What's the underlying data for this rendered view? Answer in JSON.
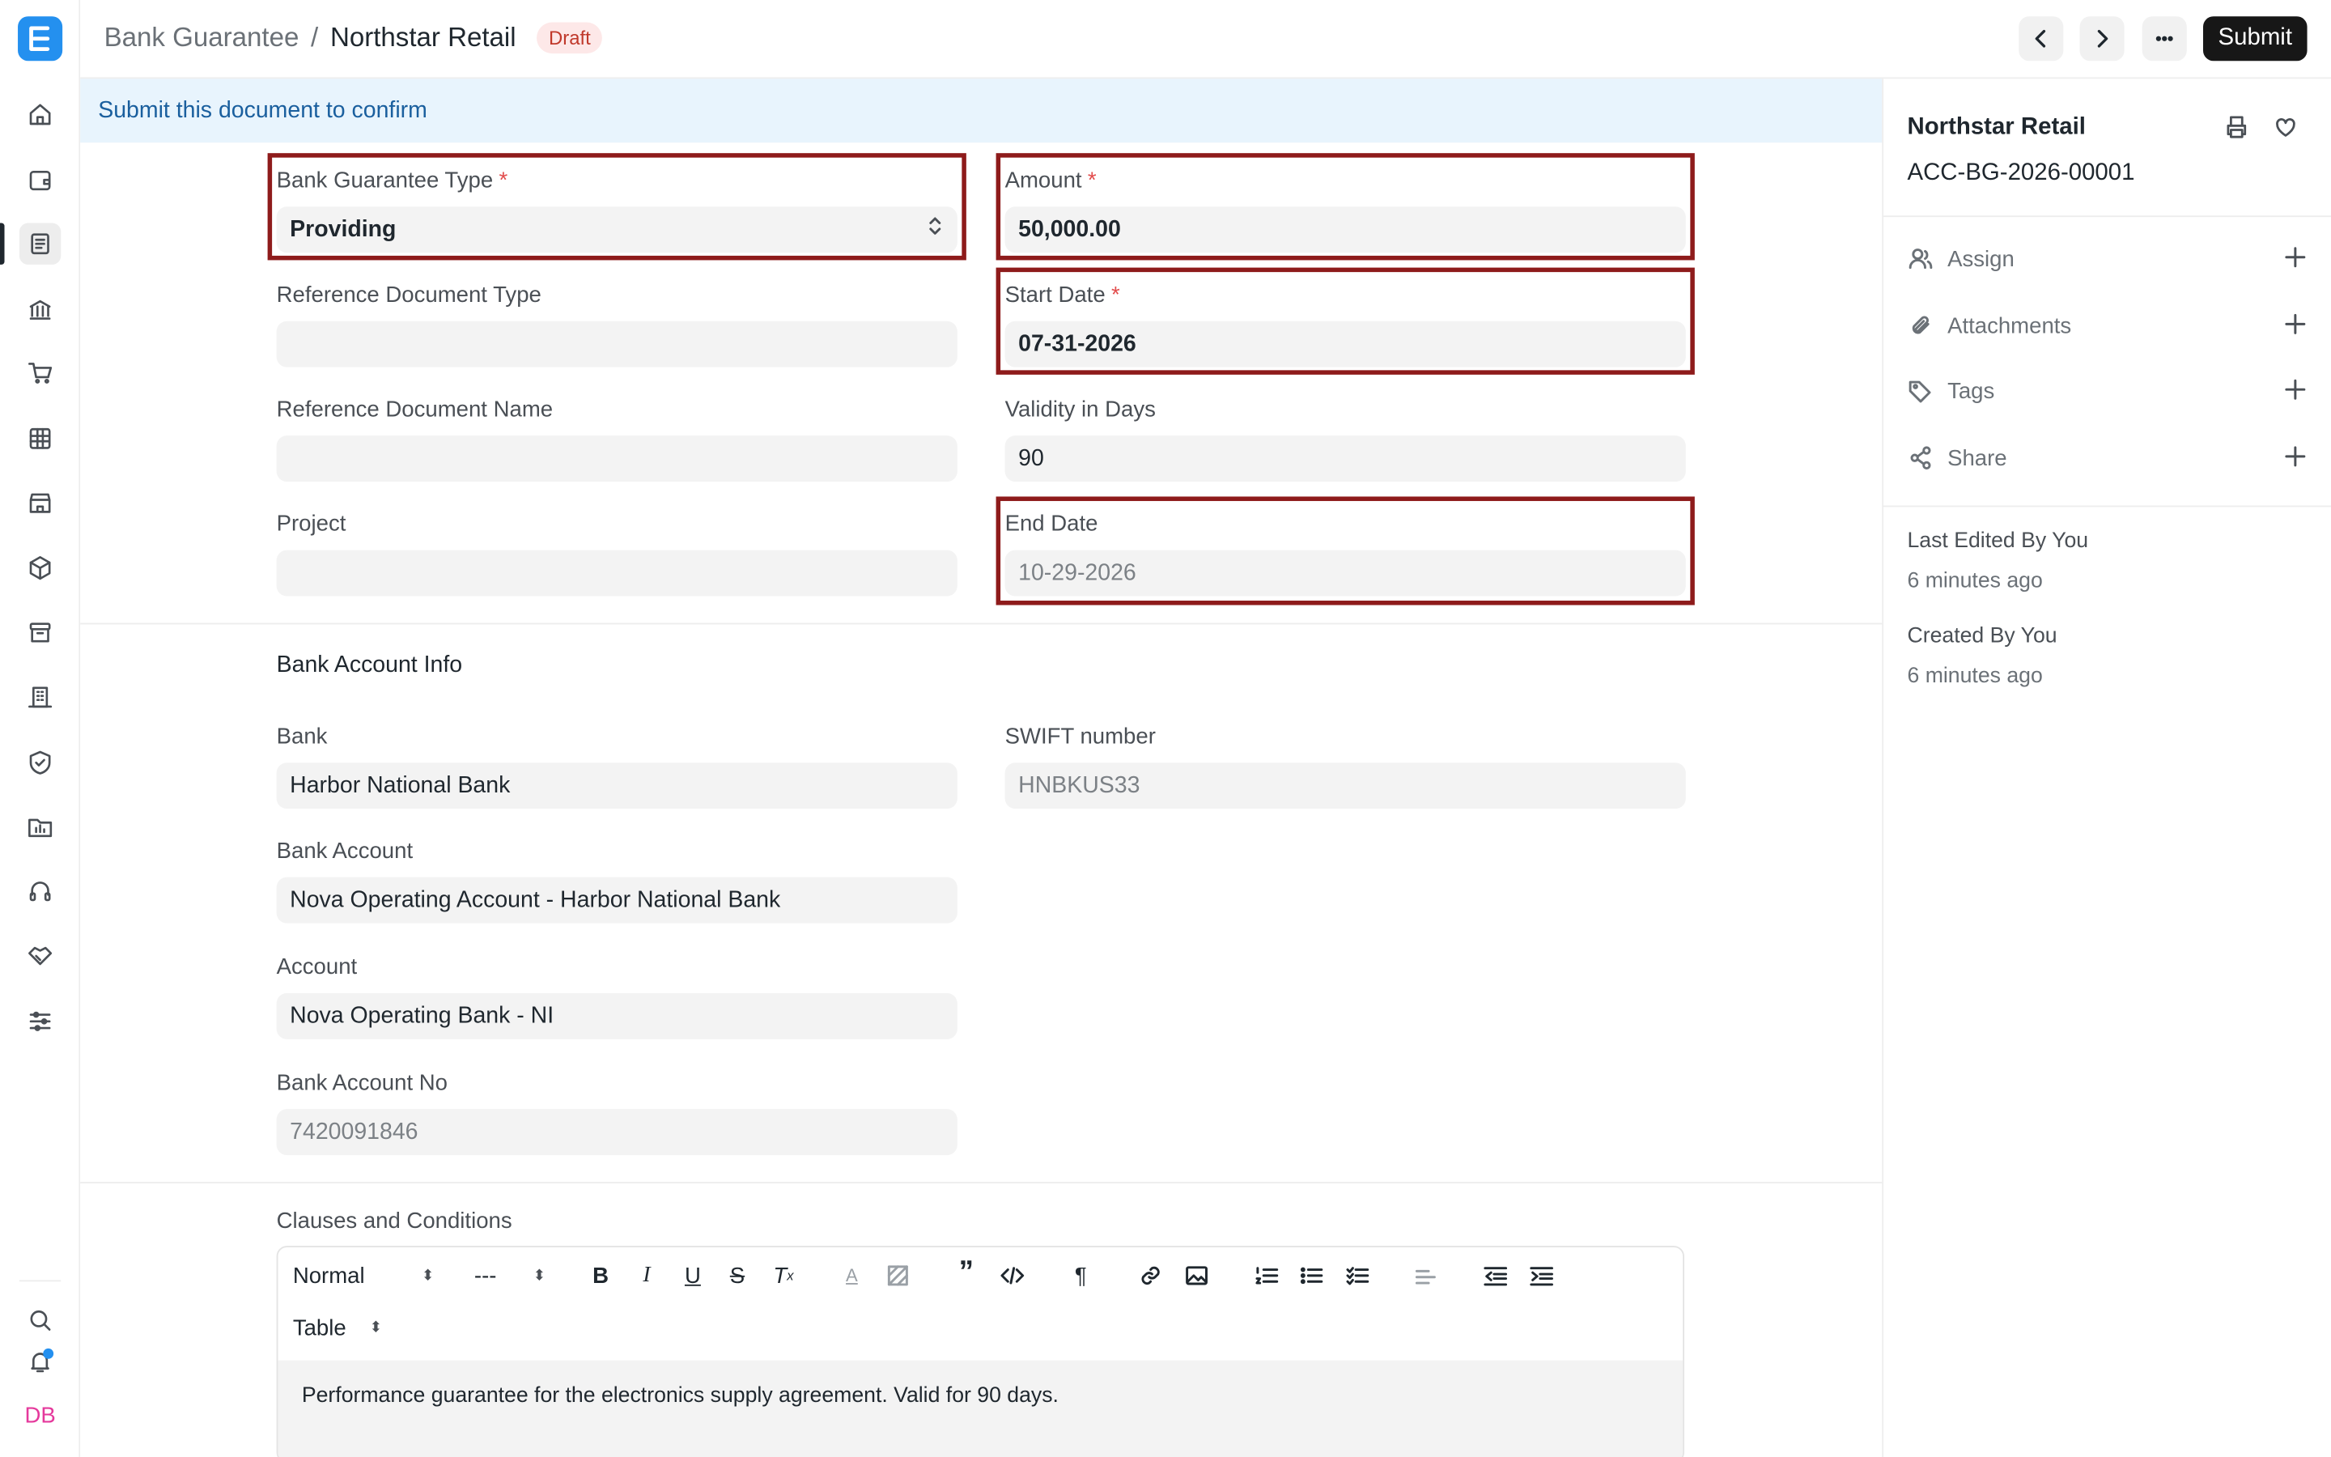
{
  "app": {
    "logo_letter": "E",
    "accent": "#2490ef",
    "avatar_initials": "DB"
  },
  "header": {
    "breadcrumb_parent": "Bank Guarantee",
    "breadcrumb_sep": "/",
    "title": "Northstar Retail",
    "status": "Draft",
    "submit_label": "Submit"
  },
  "banner": {
    "text": "Submit this document to confirm"
  },
  "form": {
    "bank_guarantee_type": {
      "label": "Bank Guarantee Type",
      "required": "*",
      "value": "Providing"
    },
    "amount": {
      "label": "Amount",
      "required": "*",
      "value": "50,000.00"
    },
    "reference_document_type": {
      "label": "Reference Document Type",
      "value": ""
    },
    "start_date": {
      "label": "Start Date",
      "required": "*",
      "value": "07-31-2026"
    },
    "reference_document_name": {
      "label": "Reference Document Name",
      "value": ""
    },
    "validity_in_days": {
      "label": "Validity in Days",
      "value": "90"
    },
    "project": {
      "label": "Project",
      "value": ""
    },
    "end_date": {
      "label": "End Date",
      "value": "10-29-2026"
    },
    "bank_section_title": "Bank Account Info",
    "bank": {
      "label": "Bank",
      "value": "Harbor National Bank"
    },
    "swift_number": {
      "label": "SWIFT number",
      "value": "HNBKUS33"
    },
    "bank_account": {
      "label": "Bank Account",
      "value": "Nova Operating Account - Harbor National Bank"
    },
    "account": {
      "label": "Account",
      "value": "Nova Operating Bank - NI"
    },
    "bank_account_no": {
      "label": "Bank Account No",
      "value": "7420091846"
    },
    "clauses": {
      "label": "Clauses and Conditions",
      "toolbar": {
        "paragraph_style": "Normal",
        "font_size": "---",
        "table_label": "Table"
      },
      "content": "Performance guarantee for the electronics supply agreement. Valid for 90 days."
    }
  },
  "sidebar": {
    "title": "Northstar Retail",
    "doc_id": "ACC-BG-2026-00001",
    "actions": [
      {
        "label": "Assign",
        "icon": "user-icon"
      },
      {
        "label": "Attachments",
        "icon": "paperclip-icon"
      },
      {
        "label": "Tags",
        "icon": "tag-icon"
      },
      {
        "label": "Share",
        "icon": "share-icon"
      }
    ],
    "last_edited_label": "Last Edited By You",
    "last_edited_time": "6 minutes ago",
    "created_label": "Created By You",
    "created_time": "6 minutes ago"
  }
}
